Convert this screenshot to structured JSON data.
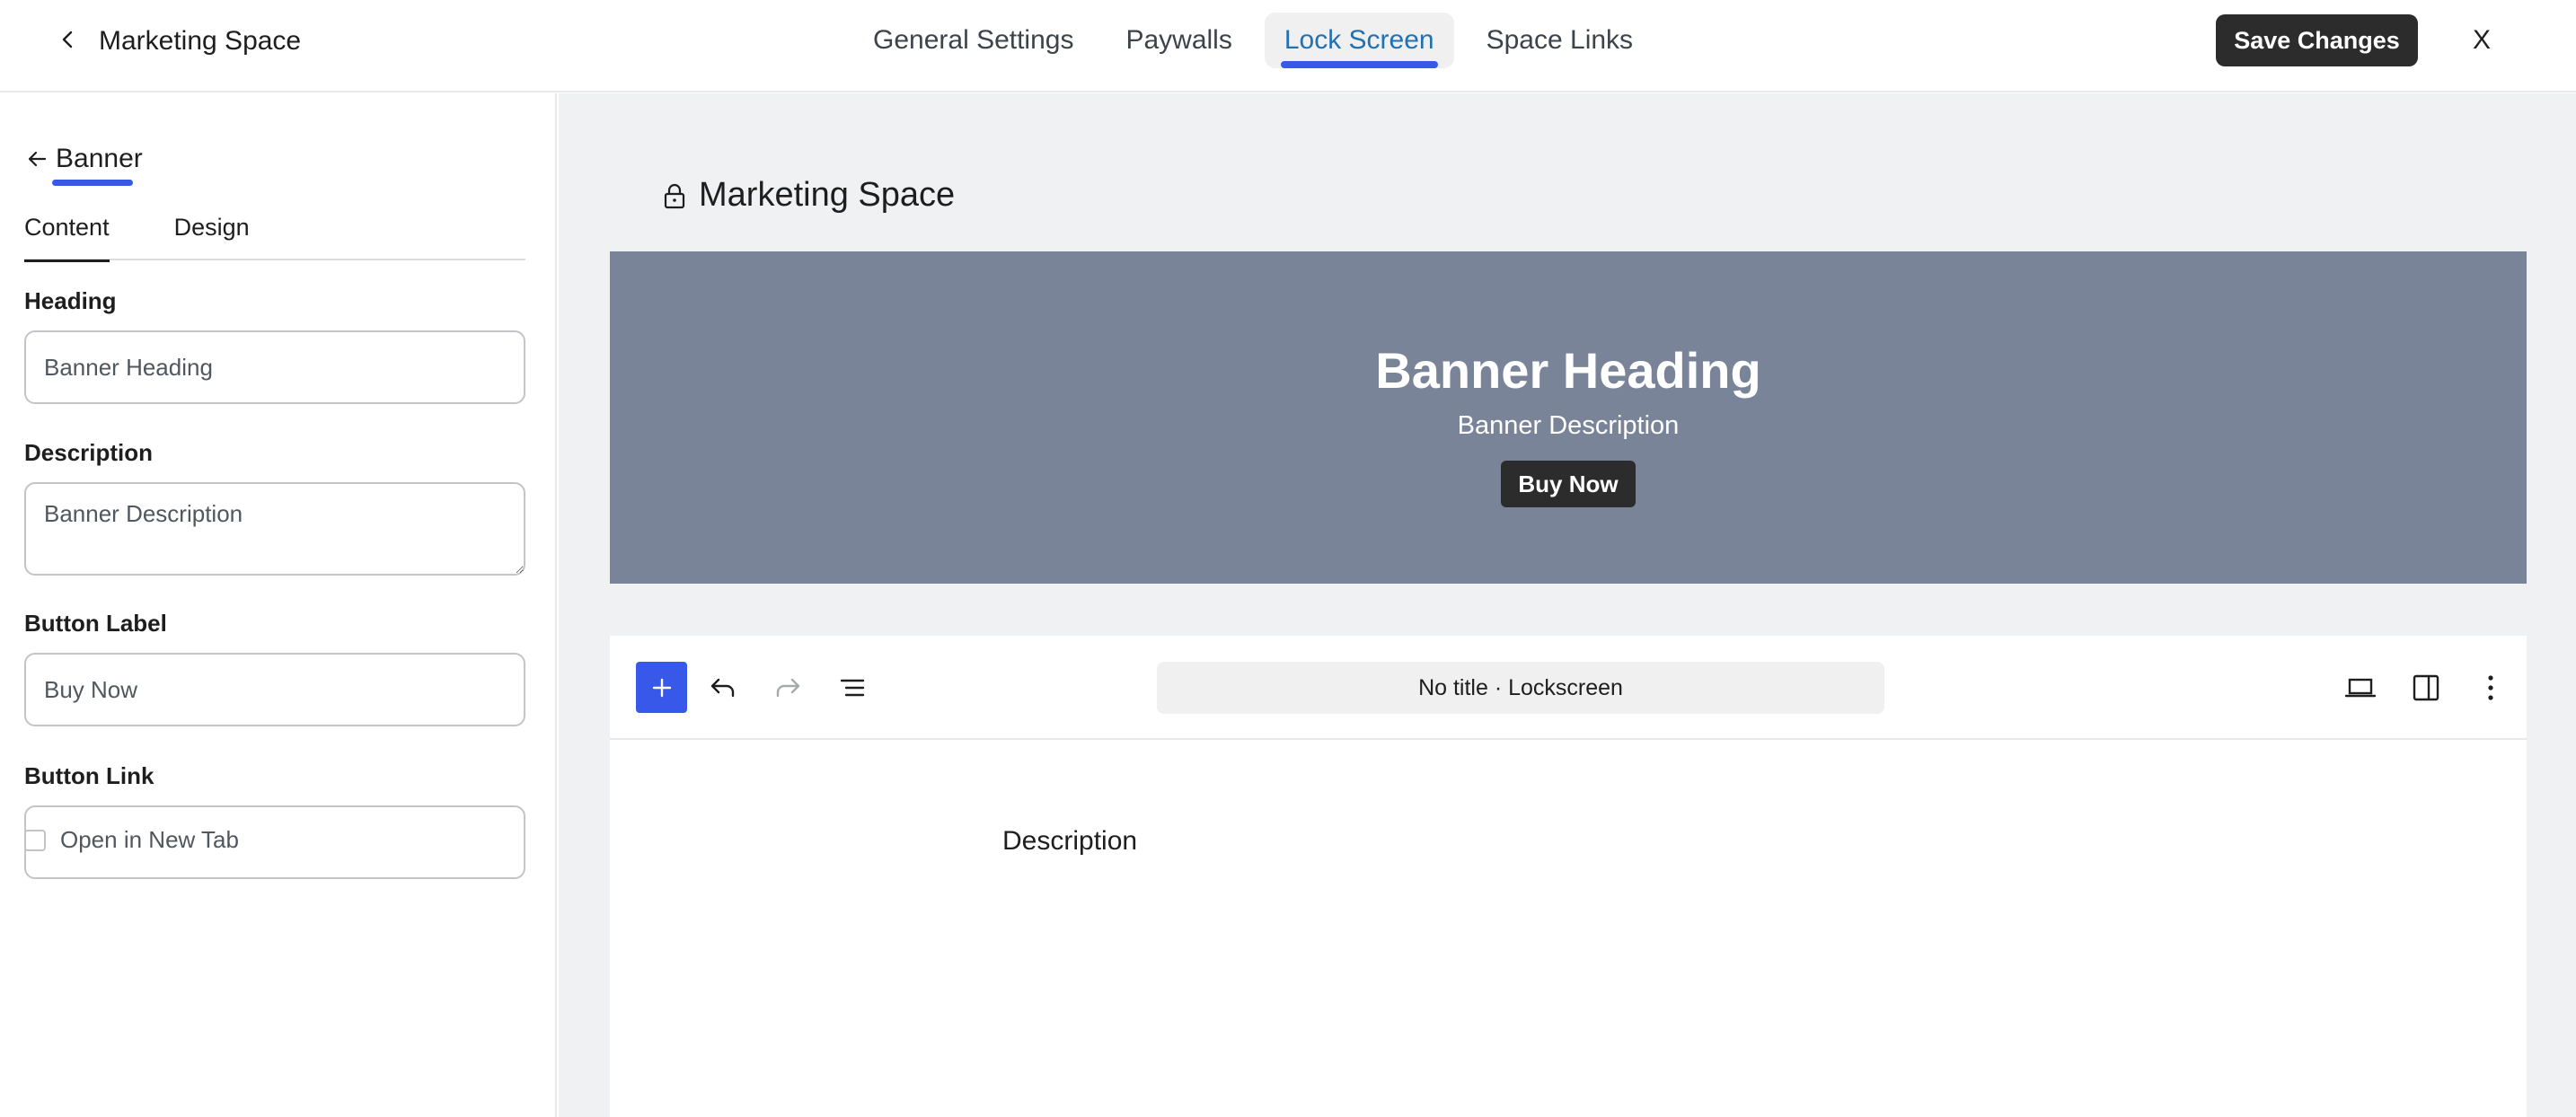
{
  "header": {
    "title": "Marketing Space",
    "tabs": [
      {
        "label": "General Settings",
        "active": false
      },
      {
        "label": "Paywalls",
        "active": false
      },
      {
        "label": "Lock Screen",
        "active": true
      },
      {
        "label": "Space Links",
        "active": false
      }
    ],
    "save_label": "Save Changes",
    "close_label": "X"
  },
  "sidebar": {
    "panel_title": "Banner",
    "subtabs": [
      {
        "label": "Content",
        "active": true
      },
      {
        "label": "Design",
        "active": false
      }
    ],
    "fields": {
      "heading_label": "Heading",
      "heading_value": "Banner Heading",
      "description_label": "Description",
      "description_value": "Banner Description",
      "button_label_label": "Button Label",
      "button_label_value": "Buy Now",
      "button_link_label": "Button Link",
      "button_link_value": ""
    },
    "open_new_tab_label": "Open in New Tab",
    "open_new_tab_checked": false
  },
  "preview": {
    "space_title": "Marketing Space",
    "banner": {
      "heading": "Banner Heading",
      "description": "Banner Description",
      "button": "Buy Now",
      "background": "#7a8499"
    }
  },
  "editor": {
    "doc_title": "No title · Lockscreen",
    "body_text": "Description"
  },
  "colors": {
    "accent": "#3858e9",
    "active_tab_text": "#2271b1",
    "dark_button": "#2c2c2c"
  }
}
